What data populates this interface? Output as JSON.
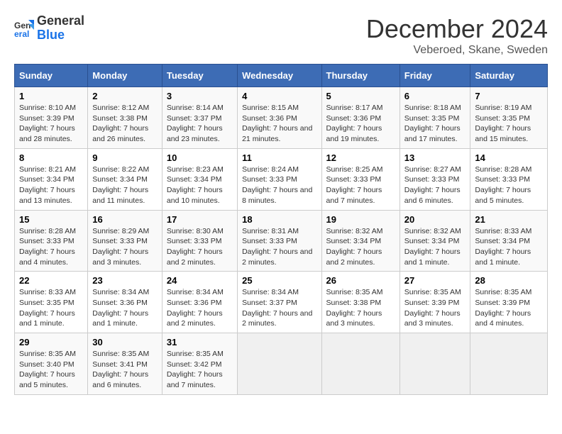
{
  "header": {
    "logo": {
      "general": "General",
      "blue": "Blue"
    },
    "title": "December 2024",
    "subtitle": "Veberoed, Skane, Sweden"
  },
  "calendar": {
    "days_of_week": [
      "Sunday",
      "Monday",
      "Tuesday",
      "Wednesday",
      "Thursday",
      "Friday",
      "Saturday"
    ],
    "weeks": [
      [
        {
          "day": "1",
          "sunrise": "8:10 AM",
          "sunset": "3:39 PM",
          "daylight": "7 hours and 28 minutes."
        },
        {
          "day": "2",
          "sunrise": "8:12 AM",
          "sunset": "3:38 PM",
          "daylight": "7 hours and 26 minutes."
        },
        {
          "day": "3",
          "sunrise": "8:14 AM",
          "sunset": "3:37 PM",
          "daylight": "7 hours and 23 minutes."
        },
        {
          "day": "4",
          "sunrise": "8:15 AM",
          "sunset": "3:36 PM",
          "daylight": "7 hours and 21 minutes."
        },
        {
          "day": "5",
          "sunrise": "8:17 AM",
          "sunset": "3:36 PM",
          "daylight": "7 hours and 19 minutes."
        },
        {
          "day": "6",
          "sunrise": "8:18 AM",
          "sunset": "3:35 PM",
          "daylight": "7 hours and 17 minutes."
        },
        {
          "day": "7",
          "sunrise": "8:19 AM",
          "sunset": "3:35 PM",
          "daylight": "7 hours and 15 minutes."
        }
      ],
      [
        {
          "day": "8",
          "sunrise": "8:21 AM",
          "sunset": "3:34 PM",
          "daylight": "7 hours and 13 minutes."
        },
        {
          "day": "9",
          "sunrise": "8:22 AM",
          "sunset": "3:34 PM",
          "daylight": "7 hours and 11 minutes."
        },
        {
          "day": "10",
          "sunrise": "8:23 AM",
          "sunset": "3:34 PM",
          "daylight": "7 hours and 10 minutes."
        },
        {
          "day": "11",
          "sunrise": "8:24 AM",
          "sunset": "3:33 PM",
          "daylight": "7 hours and 8 minutes."
        },
        {
          "day": "12",
          "sunrise": "8:25 AM",
          "sunset": "3:33 PM",
          "daylight": "7 hours and 7 minutes."
        },
        {
          "day": "13",
          "sunrise": "8:27 AM",
          "sunset": "3:33 PM",
          "daylight": "7 hours and 6 minutes."
        },
        {
          "day": "14",
          "sunrise": "8:28 AM",
          "sunset": "3:33 PM",
          "daylight": "7 hours and 5 minutes."
        }
      ],
      [
        {
          "day": "15",
          "sunrise": "8:28 AM",
          "sunset": "3:33 PM",
          "daylight": "7 hours and 4 minutes."
        },
        {
          "day": "16",
          "sunrise": "8:29 AM",
          "sunset": "3:33 PM",
          "daylight": "7 hours and 3 minutes."
        },
        {
          "day": "17",
          "sunrise": "8:30 AM",
          "sunset": "3:33 PM",
          "daylight": "7 hours and 2 minutes."
        },
        {
          "day": "18",
          "sunrise": "8:31 AM",
          "sunset": "3:33 PM",
          "daylight": "7 hours and 2 minutes."
        },
        {
          "day": "19",
          "sunrise": "8:32 AM",
          "sunset": "3:34 PM",
          "daylight": "7 hours and 2 minutes."
        },
        {
          "day": "20",
          "sunrise": "8:32 AM",
          "sunset": "3:34 PM",
          "daylight": "7 hours and 1 minute."
        },
        {
          "day": "21",
          "sunrise": "8:33 AM",
          "sunset": "3:34 PM",
          "daylight": "7 hours and 1 minute."
        }
      ],
      [
        {
          "day": "22",
          "sunrise": "8:33 AM",
          "sunset": "3:35 PM",
          "daylight": "7 hours and 1 minute."
        },
        {
          "day": "23",
          "sunrise": "8:34 AM",
          "sunset": "3:36 PM",
          "daylight": "7 hours and 1 minute."
        },
        {
          "day": "24",
          "sunrise": "8:34 AM",
          "sunset": "3:36 PM",
          "daylight": "7 hours and 2 minutes."
        },
        {
          "day": "25",
          "sunrise": "8:34 AM",
          "sunset": "3:37 PM",
          "daylight": "7 hours and 2 minutes."
        },
        {
          "day": "26",
          "sunrise": "8:35 AM",
          "sunset": "3:38 PM",
          "daylight": "7 hours and 3 minutes."
        },
        {
          "day": "27",
          "sunrise": "8:35 AM",
          "sunset": "3:39 PM",
          "daylight": "7 hours and 3 minutes."
        },
        {
          "day": "28",
          "sunrise": "8:35 AM",
          "sunset": "3:39 PM",
          "daylight": "7 hours and 4 minutes."
        }
      ],
      [
        {
          "day": "29",
          "sunrise": "8:35 AM",
          "sunset": "3:40 PM",
          "daylight": "7 hours and 5 minutes."
        },
        {
          "day": "30",
          "sunrise": "8:35 AM",
          "sunset": "3:41 PM",
          "daylight": "7 hours and 6 minutes."
        },
        {
          "day": "31",
          "sunrise": "8:35 AM",
          "sunset": "3:42 PM",
          "daylight": "7 hours and 7 minutes."
        },
        null,
        null,
        null,
        null
      ]
    ]
  }
}
